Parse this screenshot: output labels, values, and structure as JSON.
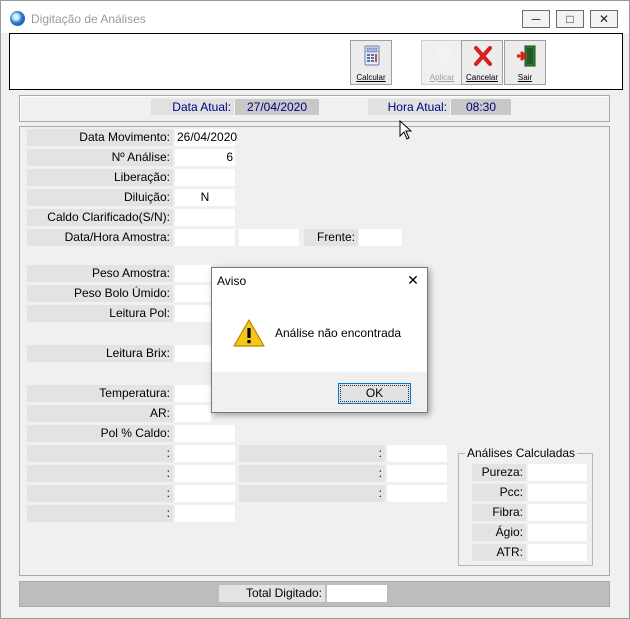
{
  "window": {
    "title": "Digitação de Análises"
  },
  "toolbar": {
    "calcular": "Calcular",
    "aplicar": "Aplicar",
    "cancelar": "Cancelar",
    "sair": "Sair"
  },
  "header": {
    "data_label": "Data Atual:",
    "data_value": "27/04/2020",
    "hora_label": "Hora Atual:",
    "hora_value": "08:30"
  },
  "form": {
    "data_movimento": {
      "label": "Data Movimento:",
      "value": "26/04/2020"
    },
    "n_analise": {
      "label": "Nº Análise:",
      "value": "6"
    },
    "liberacao": {
      "label": "Liberação:",
      "value": ""
    },
    "diluicao": {
      "label": "Diluição:",
      "value": "N"
    },
    "caldo_clarificado": {
      "label": "Caldo Clarificado(S/N):",
      "value": ""
    },
    "data_hora_amostra": {
      "label": "Data/Hora Amostra:",
      "value": ""
    },
    "frente": {
      "label": "Frente:",
      "value": ""
    },
    "peso_amostra": {
      "label": "Peso Amostra:",
      "value": ""
    },
    "peso_bolo": {
      "label": "Peso Bolo Úmido:",
      "value": ""
    },
    "leitura_pol": {
      "label": "Leitura Pol:",
      "value": ""
    },
    "leitura_brix": {
      "label": "Leitura Brix:",
      "value": ""
    },
    "temperatura": {
      "label": "Temperatura:",
      "value": ""
    },
    "ar": {
      "label": "AR:",
      "value": ""
    },
    "pol_caldo": {
      "label": "Pol % Caldo:",
      "value": ""
    },
    "extra_left": [
      ":",
      ":",
      ":",
      ":"
    ],
    "extra_mid": [
      ":",
      ":",
      ":"
    ]
  },
  "calculadas": {
    "title": "Análises Calculadas",
    "items": [
      "Pureza:",
      "Pcc:",
      "Fibra:",
      "Ágio:",
      "ATR:"
    ]
  },
  "footer": {
    "total_label": "Total Digitado:",
    "total_value": ""
  },
  "dialog": {
    "title": "Aviso",
    "message": "Análise não encontrada",
    "ok": "OK"
  }
}
